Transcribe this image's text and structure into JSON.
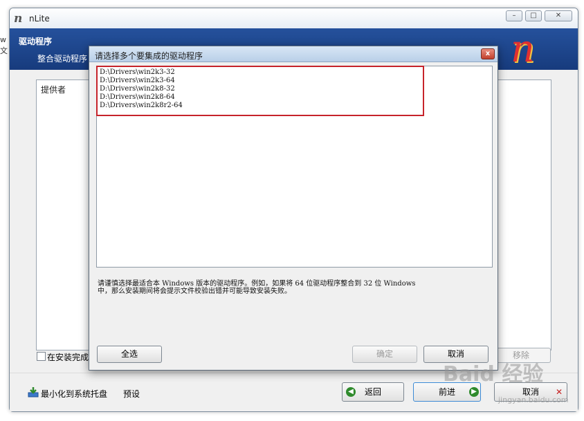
{
  "window": {
    "title": "nLite",
    "logo_char": "n"
  },
  "header": {
    "title": "驱动程序",
    "subtitle": "整合驱动程序",
    "left_clip": [
      "w",
      "文"
    ]
  },
  "provider_list": {
    "column_header": "提供者"
  },
  "install_checkbox_label": "在安装完成",
  "remove_label": "移除",
  "bottom": {
    "tray_label": "最小化到系统托盘",
    "preset_label": "预设",
    "back_label": "返回",
    "next_label": "前进",
    "cancel_label": "取消"
  },
  "dialog": {
    "title": "请选择多个要集成的驱动程序",
    "close_glyph": "x",
    "drivers": [
      "D:\\Drivers\\win2k3-32",
      "D:\\Drivers\\win2k3-64",
      "D:\\Drivers\\win2k8-32",
      "D:\\Drivers\\win2k8-64",
      "D:\\Drivers\\win2k8r2-64"
    ],
    "hint_line1": "请谨慎选择最适合本 Windows 版本的驱动程序。例如，如果将 64 位驱动程序整合到 32 位 Windows",
    "hint_line2": "中，那么安装期间将会提示文件校验出错并可能导致安装失败。",
    "select_all_label": "全选",
    "ok_label": "确定",
    "cancel_label": "取消"
  },
  "watermark": {
    "brand": "Baid 经验",
    "url": "jingyan.baidu.com"
  },
  "colors": {
    "header_band": "#1f4a92",
    "highlight": "#c6232a",
    "next_arrow": "#2f8a2c"
  }
}
